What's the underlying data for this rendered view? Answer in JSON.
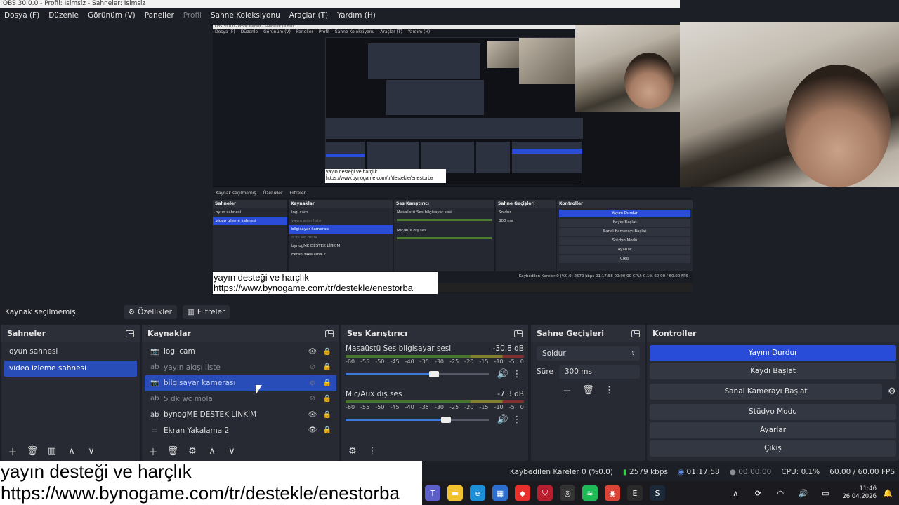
{
  "window": {
    "title": "OBS 30.0.0 - Profil: İsimsiz - Sahneler: İsimsiz"
  },
  "menu": [
    "Dosya (F)",
    "Düzenle",
    "Görünüm (V)",
    "Paneller",
    "Profil",
    "Sahne Koleksiyonu",
    "Araçlar (T)",
    "Yardım (H)"
  ],
  "toolbar": {
    "no_source": "Kaynak seçilmemiş",
    "properties": "Özellikler",
    "filters": "Filtreler"
  },
  "scenes": {
    "title": "Sahneler",
    "items": [
      "oyun sahnesi",
      "video izleme sahnesi"
    ],
    "selected": 1
  },
  "sources": {
    "title": "Kaynaklar",
    "items": [
      {
        "label": "logi cam",
        "icon": "camera-icon",
        "state": "normal"
      },
      {
        "label": "yayın akışı liste",
        "icon": "text-icon",
        "state": "hidden"
      },
      {
        "label": "bilgisayar kamerası",
        "icon": "camera-icon",
        "state": "selected"
      },
      {
        "label": "5 dk wc mola",
        "icon": "text-icon",
        "state": "hidden"
      },
      {
        "label": "bynogME DESTEK LİNKİM",
        "icon": "text-icon",
        "state": "normal"
      },
      {
        "label": "Ekran Yakalama 2",
        "icon": "monitor-icon",
        "state": "normal"
      }
    ]
  },
  "mixer": {
    "title": "Ses Karıştırıcı",
    "ticks": [
      "-60",
      "-55",
      "-50",
      "-45",
      "-40",
      "-35",
      "-30",
      "-25",
      "-20",
      "-15",
      "-10",
      "-5",
      "0"
    ],
    "channels": [
      {
        "name": "Masaüstü Ses bilgisayar sesi",
        "db": "-30.8 dB",
        "volume": 0.62
      },
      {
        "name": "Mic/Aux dış ses",
        "db": "-7.3 dB",
        "volume": 0.7
      }
    ]
  },
  "transitions": {
    "title": "Sahne Geçişleri",
    "type": "Soldur",
    "duration_label": "Süre",
    "duration": "300 ms"
  },
  "controls": {
    "title": "Kontroller",
    "buttons": [
      "Yayını Durdur",
      "Kaydı Başlat",
      "Sanal Kamerayı Başlat",
      "Stüdyo Modu",
      "Ayarlar",
      "Çıkış"
    ]
  },
  "status": {
    "dropped": "Kaybedilen Kareler 0 (%0.0)",
    "bitrate": "2579 kbps",
    "stream_time": "01:17:58",
    "rec_time": "00:00:00",
    "cpu": "CPU: 0.1%",
    "fps": "60.00 / 60.00 FPS"
  },
  "overlay": {
    "line1": "yayın desteği ve harçlık",
    "line2": "https://www.bynogame.com/tr/destekle/enestorba"
  },
  "clock": {
    "time": "11:46",
    "date": "26.04.2026"
  },
  "nested": {
    "status": "Kaybedilen Kareler 0 (%0.0)   2579 kbps   01:17:58   00:00:00   CPU: 0.1%   60.00 / 60.00 FPS"
  }
}
